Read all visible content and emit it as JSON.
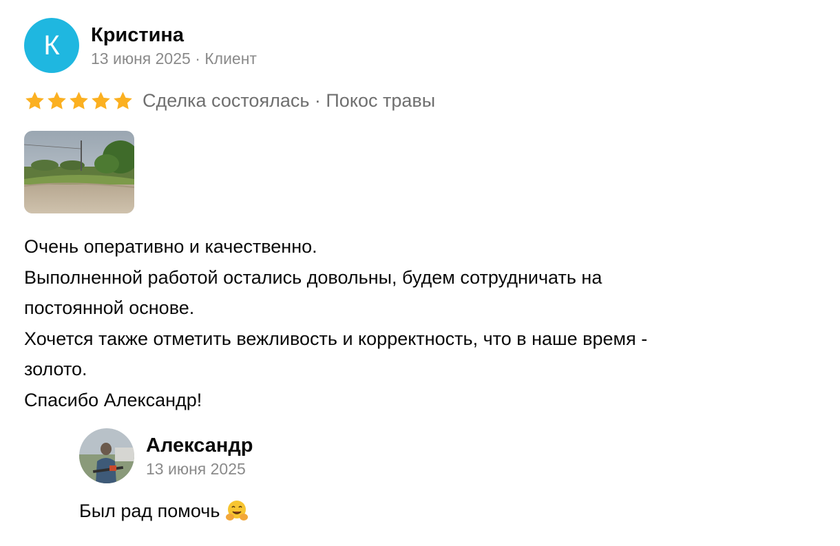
{
  "review": {
    "author": {
      "initial": "К",
      "name": "Кристина",
      "date": "13 июня 2025",
      "separator": "·",
      "role": "Клиент",
      "avatar_color": "#1fb7e0"
    },
    "rating": {
      "stars": 5,
      "max_stars": 5,
      "star_color": "#fbb021",
      "deal_text": "Сделка состоялась · Покос травы"
    },
    "photo": {
      "icon": "landscape-photo-thumbnail"
    },
    "text_lines": [
      "Очень оперативно и качественно.",
      "Выполненной работой остались довольны, будем сотрудничать на",
      "постоянной основе.",
      "Хочется также отметить вежливость и корректность, что в наше время -",
      "золото.",
      "Спасибо Александр!"
    ]
  },
  "reply": {
    "author": {
      "name": "Александр",
      "date": "13 июня 2025"
    },
    "text": "Был рад помочь",
    "emoji": "hugging-face-emoji"
  }
}
